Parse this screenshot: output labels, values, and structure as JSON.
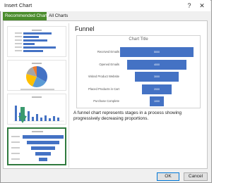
{
  "window": {
    "title": "Insert Chart",
    "help_glyph": "?",
    "close_glyph": "✕"
  },
  "tabs": [
    {
      "label": "Recommended Charts",
      "active": true
    },
    {
      "label": "All Charts",
      "active": false
    }
  ],
  "thumbnails": [
    {
      "name": "bar-chart-thumbnail"
    },
    {
      "name": "pie-chart-thumbnail"
    },
    {
      "name": "column-chart-thumbnail"
    },
    {
      "name": "funnel-chart-thumbnail",
      "selected": true
    }
  ],
  "preview": {
    "heading": "Funnel",
    "description": "A funnel chart represents stages in a process showing progressively decreasing proportions."
  },
  "chart_data": {
    "type": "bar",
    "subtype": "funnel",
    "title": "Chart Title",
    "categories": [
      "Received Emails",
      "Opened Emails",
      "Visited Product Website",
      "Placed Products in Cart",
      "Purchase Complete"
    ],
    "values": [
      5000,
      4000,
      3000,
      2000,
      1000
    ],
    "value_labels": [
      "5000",
      "4000",
      "3000",
      "2000",
      "1000"
    ],
    "bar_color": "#4472c4"
  },
  "buttons": {
    "ok": "OK",
    "cancel": "Cancel"
  },
  "colors": {
    "tab_active": "#4a8c2c",
    "selection": "#2f7a3e",
    "accent": "#4472c4"
  }
}
